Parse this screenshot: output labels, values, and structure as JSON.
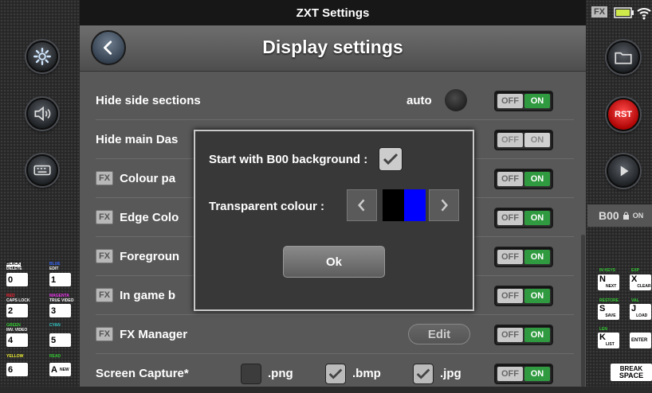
{
  "window_title": "ZXT Settings",
  "page_title": "Display settings",
  "status": {
    "fx_label": "FX"
  },
  "rows": [
    {
      "label": "Hide side sections",
      "fx": false,
      "auto_label": "auto",
      "toggle": {
        "off": "OFF",
        "on": "ON",
        "enabled": true
      }
    },
    {
      "label": "Hide main Das",
      "fx": false,
      "toggle": {
        "off": "OFF",
        "on": "ON",
        "enabled": false
      }
    },
    {
      "label": "Colour pa",
      "fx": true,
      "toggle": {
        "off": "OFF",
        "on": "ON",
        "enabled": true
      }
    },
    {
      "label": "Edge Colo",
      "fx": true,
      "toggle": {
        "off": "OFF",
        "on": "ON",
        "enabled": true
      }
    },
    {
      "label": "Foregroun",
      "fx": true,
      "toggle": {
        "off": "OFF",
        "on": "ON",
        "enabled": true
      }
    },
    {
      "label": "In game b",
      "fx": true,
      "toggle": {
        "off": "OFF",
        "on": "ON",
        "enabled": true
      }
    },
    {
      "label": "FX Manager",
      "fx": true,
      "edit_label": "Edit",
      "toggle": {
        "off": "OFF",
        "on": "ON",
        "enabled": true
      }
    },
    {
      "label": "Screen Capture*",
      "fx": false,
      "toggle": {
        "off": "OFF",
        "on": "ON",
        "enabled": true
      }
    }
  ],
  "fx_badge": "FX",
  "capture_options": [
    {
      "label": ".png",
      "checked": false
    },
    {
      "label": ".bmp",
      "checked": true
    },
    {
      "label": ".jpg",
      "checked": true
    }
  ],
  "modal": {
    "start_label": "Start with B00 background :",
    "start_checked": true,
    "transparent_label": "Transparent colour :",
    "swatch_colors": [
      "#000000",
      "#0000ff"
    ],
    "ok_label": "Ok"
  },
  "right_panel": {
    "b00_label": "B00",
    "b00_state": "ON",
    "rst_label": "RST",
    "space_top": "BREAK",
    "space_bottom": "SPACE"
  },
  "left_keys": {
    "row0": {
      "k1": "0",
      "k2": "1",
      "top1": "BLACK",
      "top1b": "DELETE",
      "top2": "BLUE",
      "top2b": "EDIT"
    },
    "row1": {
      "k1": "2",
      "k2": "3",
      "top1": "RED",
      "top1b": "CAPS LOCK",
      "top2": "MAGENTA",
      "top2b": "TRUE VIDEO"
    },
    "row2": {
      "k1": "4",
      "k2": "5",
      "top1": "GREEN",
      "top1b": "INV. VIDEO",
      "top2": "CYAN"
    },
    "row3": {
      "k1": "6",
      "k2": "A",
      "top1": "YELLOW",
      "top2": "READ",
      "k2b": "NEW"
    }
  },
  "right_keys": [
    {
      "k": "N",
      "sub": "NEXT",
      "top": "IN KEYS"
    },
    {
      "k": "X",
      "sub": "CLEAR",
      "top": "EXP"
    },
    {
      "k": "S",
      "sub": "SAVE",
      "top": "RESTORE"
    },
    {
      "k": "J",
      "sub": "LOAD",
      "top": "VAL"
    },
    {
      "k": "K",
      "sub": "LIST",
      "top": "LEN"
    },
    {
      "k": "ENTER",
      "sub": "",
      "top": ""
    }
  ],
  "colors": {
    "on_green": "#2f9a3f",
    "panel": "#585858",
    "rst_red": "#e01010"
  }
}
